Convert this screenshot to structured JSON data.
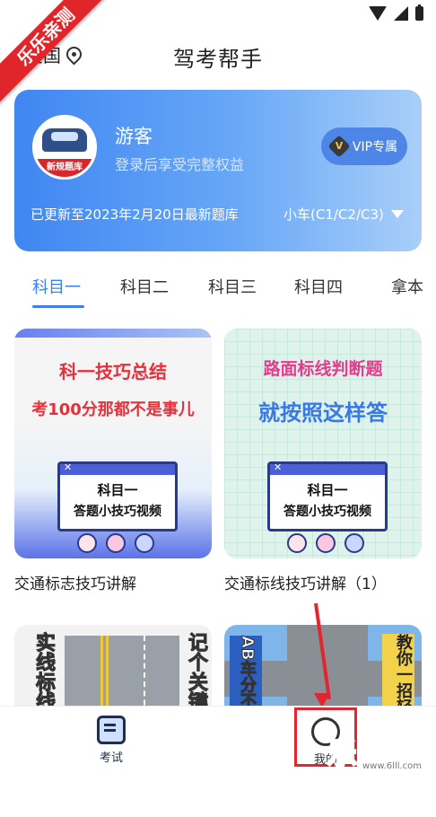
{
  "watermark": {
    "corner": "乐乐亲测",
    "logo": "乐乐游戏",
    "url": "www.6lll.com"
  },
  "header": {
    "location": "全国",
    "title": "驾考帮手"
  },
  "user": {
    "name": "游客",
    "subtitle": "登录后享受完整权益",
    "vip_label": "VIP专属",
    "vip_icon": "V",
    "avatar_text": "新规题库",
    "update_text": "已更新至2023年2月20日最新题库",
    "car_type": "小车(C1/C2/C3)"
  },
  "tabs": [
    "科目一",
    "科目二",
    "科目三",
    "科目四",
    "拿本"
  ],
  "videos": [
    {
      "line1": "科一技巧总结",
      "line2": "考100分那都不是事儿",
      "box_title": "科目一",
      "box_sub": "答题小技巧视频",
      "caption": "交通标志技巧讲解"
    },
    {
      "line1": "路面标线判断题",
      "line2": "就按照这样答",
      "box_title": "科目一",
      "box_sub": "答题小技巧视频",
      "caption": "交通标线技巧讲解（1）"
    },
    {
      "left_text": "实线标线",
      "right_text": "记个关键"
    },
    {
      "left_text": "AB车分不",
      "right_text": "教你一招轻"
    }
  ],
  "nav": {
    "exam": "考试",
    "me": "我的"
  },
  "colors": {
    "accent": "#3d7ff0",
    "annotation": "#e2262f"
  }
}
